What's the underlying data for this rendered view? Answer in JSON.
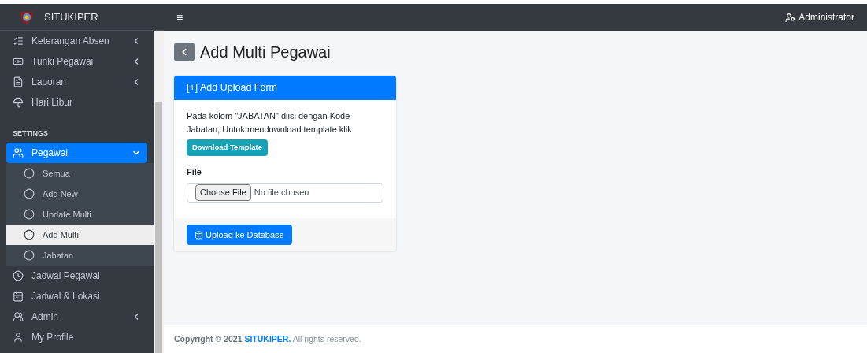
{
  "brand": "SITUKIPER",
  "topbar": {
    "menu_icon": "≡",
    "user": "Administrator"
  },
  "sidebar": {
    "items": [
      {
        "kind": "item",
        "label": "Keterangan Absen",
        "expanded": false
      },
      {
        "kind": "item",
        "label": "Tunki Pegawai",
        "expanded": false
      },
      {
        "kind": "item",
        "label": "Laporan",
        "expanded": false
      },
      {
        "kind": "item",
        "label": "Hari Libur"
      },
      {
        "kind": "header",
        "label": "SETTINGS"
      },
      {
        "kind": "item",
        "label": "Pegawai",
        "selected": true,
        "expanded": true,
        "children": [
          {
            "label": "Semua",
            "selected": false
          },
          {
            "label": "Add New",
            "selected": false
          },
          {
            "label": "Update Multi",
            "selected": false
          },
          {
            "label": "Add Multi",
            "selected": true
          },
          {
            "label": "Jabatan",
            "selected": false
          }
        ]
      },
      {
        "kind": "item",
        "label": "Jadwal Pegawai"
      },
      {
        "kind": "item",
        "label": "Jadwal & Lokasi"
      },
      {
        "kind": "item",
        "label": "Admin",
        "expanded": false
      },
      {
        "kind": "item",
        "label": "My Profile"
      }
    ]
  },
  "page_title": "Add Multi Pegawai",
  "card": {
    "header": "[+] Add Upload Form",
    "instruction": "Pada kolom \"JABATAN\" diisi dengan Kode Jabatan, Untuk mendownload template klik",
    "download_button": "Download Template",
    "file_label": "File",
    "choose_button": "Choose File",
    "file_status": "No file chosen",
    "submit_button": "Upload ke Database"
  },
  "footer": {
    "prefix": "Copyright © 2021",
    "link": "SITUKIPER.",
    "suffix": "All rights reserved."
  }
}
